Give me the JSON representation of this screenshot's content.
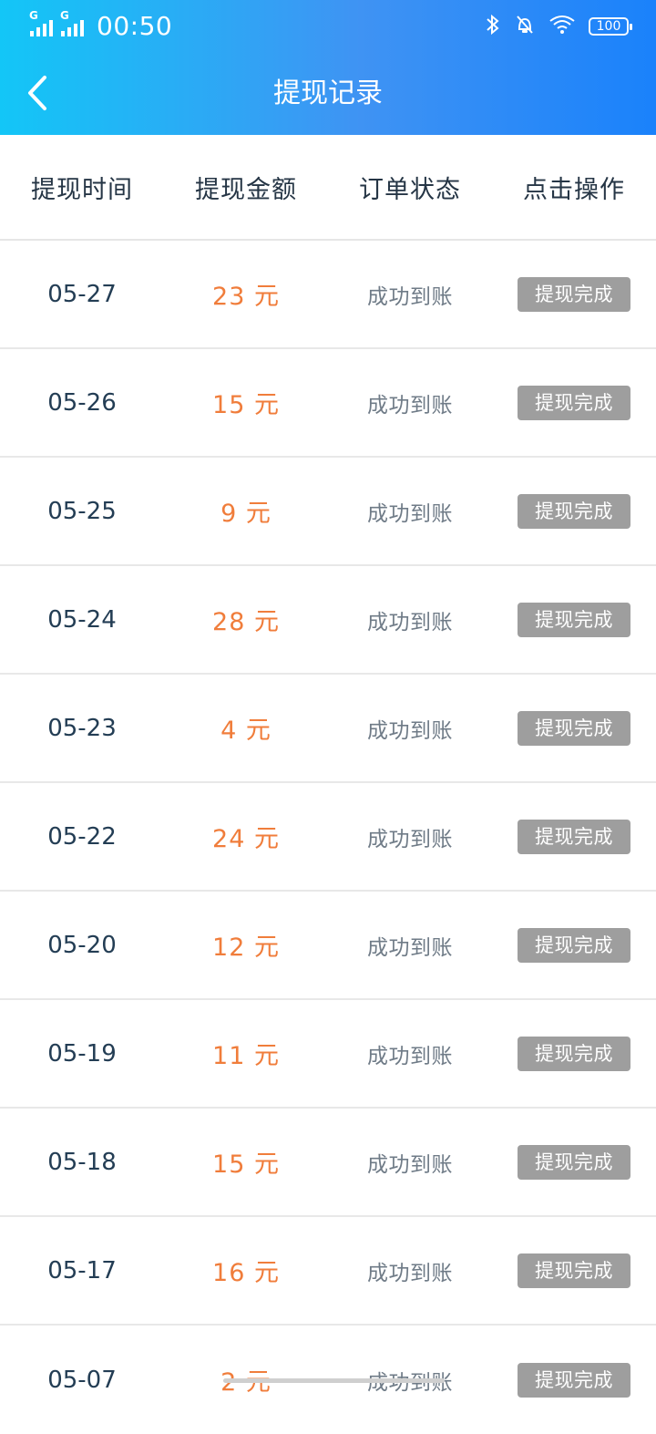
{
  "status_bar": {
    "time": "00:50",
    "signal_1_label": "G",
    "signal_2_label": "G",
    "battery": "100"
  },
  "header": {
    "title": "提现记录"
  },
  "table": {
    "headers": [
      "提现时间",
      "提现金额",
      "订单状态",
      "点击操作"
    ],
    "rows": [
      {
        "date": "05-27",
        "amount": "23 元",
        "status": "成功到账",
        "action": "提现完成"
      },
      {
        "date": "05-26",
        "amount": "15 元",
        "status": "成功到账",
        "action": "提现完成"
      },
      {
        "date": "05-25",
        "amount": "9 元",
        "status": "成功到账",
        "action": "提现完成"
      },
      {
        "date": "05-24",
        "amount": "28 元",
        "status": "成功到账",
        "action": "提现完成"
      },
      {
        "date": "05-23",
        "amount": "4 元",
        "status": "成功到账",
        "action": "提现完成"
      },
      {
        "date": "05-22",
        "amount": "24 元",
        "status": "成功到账",
        "action": "提现完成"
      },
      {
        "date": "05-20",
        "amount": "12 元",
        "status": "成功到账",
        "action": "提现完成"
      },
      {
        "date": "05-19",
        "amount": "11 元",
        "status": "成功到账",
        "action": "提现完成"
      },
      {
        "date": "05-18",
        "amount": "15 元",
        "status": "成功到账",
        "action": "提现完成"
      },
      {
        "date": "05-17",
        "amount": "16 元",
        "status": "成功到账",
        "action": "提现完成"
      },
      {
        "date": "05-07",
        "amount": "2 元",
        "status": "成功到账",
        "action": "提现完成"
      }
    ]
  },
  "icons": {
    "back": "chevron-left-icon",
    "bluetooth": "bluetooth-icon",
    "mute": "bell-off-icon",
    "wifi": "wifi-icon",
    "battery": "battery-icon",
    "signal": "signal-icon"
  },
  "colors": {
    "header_gradient_start": "#13c6f7",
    "header_gradient_end": "#1a82fb",
    "amount": "#f07d3b",
    "done_button_bg": "#9e9e9e"
  }
}
